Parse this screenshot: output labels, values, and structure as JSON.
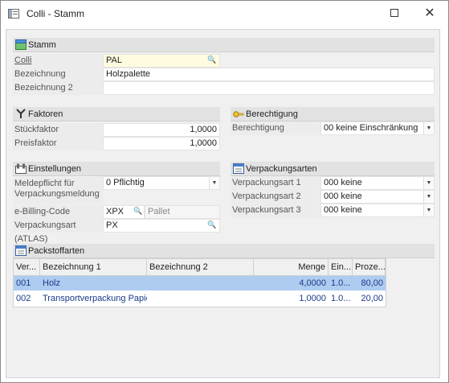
{
  "window": {
    "title": "Colli - Stamm"
  },
  "stamm": {
    "header": "Stamm",
    "colli_label": "Colli",
    "colli_value": "PAL",
    "bezeichnung_label": "Bezeichnung",
    "bezeichnung_value": "Holzpalette",
    "bezeichnung2_label": "Bezeichnung 2",
    "bezeichnung2_value": ""
  },
  "faktoren": {
    "header": "Faktoren",
    "stueck_label": "Stückfaktor",
    "stueck_value": "1,0000",
    "preis_label": "Preisfaktor",
    "preis_value": "1,0000"
  },
  "berechtigung": {
    "header": "Berechtigung",
    "label": "Berechtigung",
    "value": "00 keine Einschränkung"
  },
  "einstellungen": {
    "header": "Einstellungen",
    "meldepflicht_label_1": "Meldepflicht für",
    "meldepflicht_label_2": "Verpackungsmeldung",
    "meldepflicht_value": "0 Pflichtig",
    "billing_label": "e-Billing-Code",
    "billing_code": "XPX",
    "billing_desc": "Pallet",
    "atlas_label": "Verpackungsart (ATLAS)",
    "atlas_value": "PX"
  },
  "verpackungsarten": {
    "header": "Verpackungsarten",
    "items": [
      {
        "label": "Verpackungsart 1",
        "value": "000 keine"
      },
      {
        "label": "Verpackungsart 2",
        "value": "000 keine"
      },
      {
        "label": "Verpackungsart 3",
        "value": "000 keine"
      }
    ]
  },
  "packstoffarten": {
    "header": "Packstoffarten",
    "columns": [
      "Ver...",
      "Bezeichnung 1",
      "Bezeichnung 2",
      "Menge",
      "Ein...",
      "Proze..."
    ],
    "rows": [
      {
        "ver": "001",
        "bez1": "Holz",
        "bez2": "",
        "menge": "4,0000",
        "ein": "1.0...",
        "proz": "80,00"
      },
      {
        "ver": "002",
        "bez1": "Transportverpackung Papier",
        "bez2": "",
        "menge": "1,0000",
        "ein": "1.0...",
        "proz": "20,00"
      }
    ]
  },
  "colors": {
    "selection": "#aecbf0",
    "highlight_field": "#fffbe0",
    "group_header": "#e2e2e2",
    "link_text": "#1a3a8a"
  }
}
